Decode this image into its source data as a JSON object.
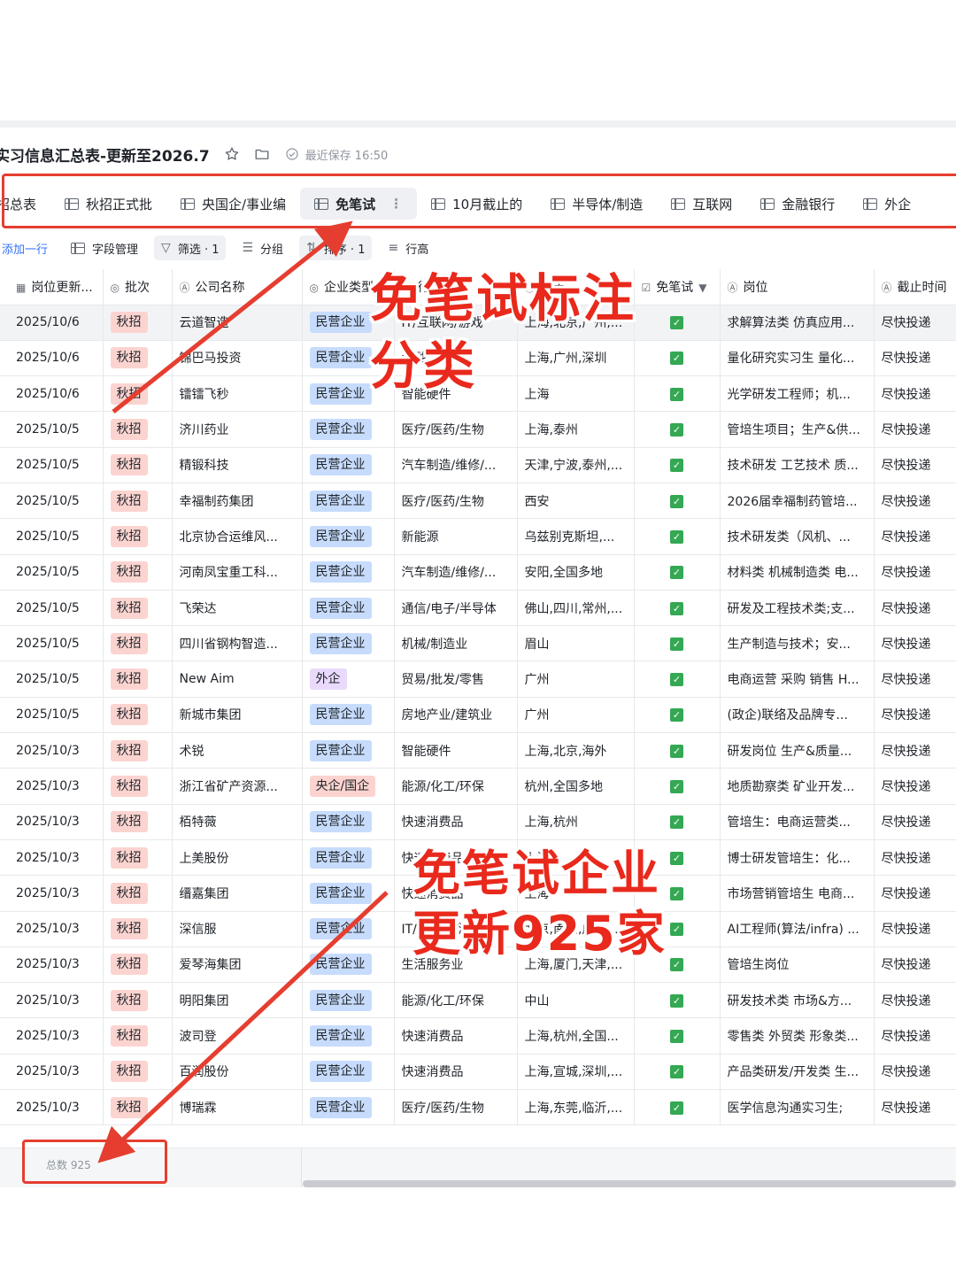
{
  "doc": {
    "title": "实习信息汇总表-更新至2026.7",
    "save_status": "最近保存 16:50"
  },
  "tabs": [
    {
      "label": "招总表",
      "active": false
    },
    {
      "label": "秋招正式批",
      "active": false
    },
    {
      "label": "央国企/事业编",
      "active": false
    },
    {
      "label": "免笔试",
      "active": true
    },
    {
      "label": "10月截止的",
      "active": false
    },
    {
      "label": "半导体/制造",
      "active": false
    },
    {
      "label": "互联网",
      "active": false
    },
    {
      "label": "金融银行",
      "active": false
    },
    {
      "label": "外企",
      "active": false
    }
  ],
  "toolbar": {
    "add_row": "添加一行",
    "fields": "字段管理",
    "filter": "筛选 · 1",
    "group": "分组",
    "sort": "排序 · 1",
    "row_height": "行高"
  },
  "columns": [
    "岗位更新...",
    "批次",
    "公司名称",
    "企业类型",
    "行业",
    "城市",
    "免笔试",
    "岗位",
    "截止时间"
  ],
  "rows": [
    {
      "date": "2025/10/6",
      "batch": "秋招",
      "company": "云道智造",
      "type": "民营企业",
      "industry": "IT/互联网/游戏",
      "city": "上海,北京,广州,...",
      "no_exam": true,
      "position": "求解算法类 仿真应用...",
      "deadline": "尽快投递"
    },
    {
      "date": "2025/10/6",
      "batch": "秋招",
      "company": "锦巴马投资",
      "type": "民营企业",
      "industry": "金融",
      "city": "上海,广州,深圳",
      "no_exam": true,
      "position": "量化研究实习生 量化...",
      "deadline": "尽快投递"
    },
    {
      "date": "2025/10/6",
      "batch": "秋招",
      "company": "镭镭飞秒",
      "type": "民营企业",
      "industry": "智能硬件",
      "city": "上海",
      "no_exam": true,
      "position": "光学研发工程师；机...",
      "deadline": "尽快投递"
    },
    {
      "date": "2025/10/5",
      "batch": "秋招",
      "company": "济川药业",
      "type": "民营企业",
      "industry": "医疗/医药/生物",
      "city": "上海,泰州",
      "no_exam": true,
      "position": "管培生项目；生产&供...",
      "deadline": "尽快投递"
    },
    {
      "date": "2025/10/5",
      "batch": "秋招",
      "company": "精锻科技",
      "type": "民营企业",
      "industry": "汽车制造/维修/...",
      "city": "天津,宁波,泰州,...",
      "no_exam": true,
      "position": "技术研发 工艺技术 质...",
      "deadline": "尽快投递"
    },
    {
      "date": "2025/10/5",
      "batch": "秋招",
      "company": "幸福制药集团",
      "type": "民营企业",
      "industry": "医疗/医药/生物",
      "city": "西安",
      "no_exam": true,
      "position": "2026届幸福制药管培...",
      "deadline": "尽快投递"
    },
    {
      "date": "2025/10/5",
      "batch": "秋招",
      "company": "北京协合运维风...",
      "type": "民营企业",
      "industry": "新能源",
      "city": "乌兹别克斯坦,...",
      "no_exam": true,
      "position": "技术研发类（风机、...",
      "deadline": "尽快投递"
    },
    {
      "date": "2025/10/5",
      "batch": "秋招",
      "company": "河南凤宝重工科...",
      "type": "民营企业",
      "industry": "汽车制造/维修/...",
      "city": "安阳,全国多地",
      "no_exam": true,
      "position": "材料类 机械制造类 电...",
      "deadline": "尽快投递"
    },
    {
      "date": "2025/10/5",
      "batch": "秋招",
      "company": "飞荣达",
      "type": "民营企业",
      "industry": "通信/电子/半导体",
      "city": "佛山,四川,常州,...",
      "no_exam": true,
      "position": "研发及工程技术类;支...",
      "deadline": "尽快投递"
    },
    {
      "date": "2025/10/5",
      "batch": "秋招",
      "company": "四川省钢构智造...",
      "type": "民营企业",
      "industry": "机械/制造业",
      "city": "眉山",
      "no_exam": true,
      "position": "生产制造与技术；安...",
      "deadline": "尽快投递"
    },
    {
      "date": "2025/10/5",
      "batch": "秋招",
      "company": "New Aim",
      "type": "外企",
      "industry": "贸易/批发/零售",
      "city": "广州",
      "no_exam": true,
      "position": "电商运营 采购 销售 H...",
      "deadline": "尽快投递"
    },
    {
      "date": "2025/10/5",
      "batch": "秋招",
      "company": "新城市集团",
      "type": "民营企业",
      "industry": "房地产业/建筑业",
      "city": "广州",
      "no_exam": true,
      "position": "(政企)联络及品牌专...",
      "deadline": "尽快投递"
    },
    {
      "date": "2025/10/3",
      "batch": "秋招",
      "company": "术锐",
      "type": "民营企业",
      "industry": "智能硬件",
      "city": "上海,北京,海外",
      "no_exam": true,
      "position": "研发岗位 生产&质量...",
      "deadline": "尽快投递"
    },
    {
      "date": "2025/10/3",
      "batch": "秋招",
      "company": "浙江省矿产资源...",
      "type": "央企/国企",
      "industry": "能源/化工/环保",
      "city": "杭州,全国多地",
      "no_exam": true,
      "position": "地质勘察类 矿业开发...",
      "deadline": "尽快投递"
    },
    {
      "date": "2025/10/3",
      "batch": "秋招",
      "company": "栢特薇",
      "type": "民营企业",
      "industry": "快速消费品",
      "city": "上海,杭州",
      "no_exam": true,
      "position": "管培生：电商运营类...",
      "deadline": "尽快投递"
    },
    {
      "date": "2025/10/3",
      "batch": "秋招",
      "company": "上美股份",
      "type": "民营企业",
      "industry": "快速消费品",
      "city": "上海",
      "no_exam": true,
      "position": "博士研发管培生：化...",
      "deadline": "尽快投递"
    },
    {
      "date": "2025/10/3",
      "batch": "秋招",
      "company": "缙嘉集团",
      "type": "民营企业",
      "industry": "快速消费品",
      "city": "上海",
      "no_exam": true,
      "position": "市场营销管培生 电商...",
      "deadline": "尽快投递"
    },
    {
      "date": "2025/10/3",
      "batch": "秋招",
      "company": "深信服",
      "type": "民营企业",
      "industry": "IT/互联网/游戏",
      "city": "北京,南京,成都,...",
      "no_exam": true,
      "position": "AI工程师(算法/infra) ...",
      "deadline": "尽快投递"
    },
    {
      "date": "2025/10/3",
      "batch": "秋招",
      "company": "爱琴海集团",
      "type": "民营企业",
      "industry": "生活服务业",
      "city": "上海,厦门,天津,...",
      "no_exam": true,
      "position": "管培生岗位",
      "deadline": "尽快投递"
    },
    {
      "date": "2025/10/3",
      "batch": "秋招",
      "company": "明阳集团",
      "type": "民营企业",
      "industry": "能源/化工/环保",
      "city": "中山",
      "no_exam": true,
      "position": "研发技术类 市场&方...",
      "deadline": "尽快投递"
    },
    {
      "date": "2025/10/3",
      "batch": "秋招",
      "company": "波司登",
      "type": "民营企业",
      "industry": "快速消费品",
      "city": "上海,杭州,全国...",
      "no_exam": true,
      "position": "零售类 外贸类 形象类...",
      "deadline": "尽快投递"
    },
    {
      "date": "2025/10/3",
      "batch": "秋招",
      "company": "百润股份",
      "type": "民营企业",
      "industry": "快速消费品",
      "city": "上海,宣城,深圳,...",
      "no_exam": true,
      "position": "产品类研发/开发类 生...",
      "deadline": "尽快投递"
    },
    {
      "date": "2025/10/3",
      "batch": "秋招",
      "company": "博瑞霖",
      "type": "民营企业",
      "industry": "医疗/医药/生物",
      "city": "上海,东莞,临沂,...",
      "no_exam": true,
      "position": "医学信息沟通实习生;",
      "deadline": "尽快投递"
    }
  ],
  "footer": {
    "total": "总数 925"
  },
  "annotations": {
    "top_line1": "免笔试标注",
    "top_line2": "分类",
    "mid_line1": "免笔试企业",
    "mid_line2": "更新925家",
    "color": "#e8291c"
  }
}
